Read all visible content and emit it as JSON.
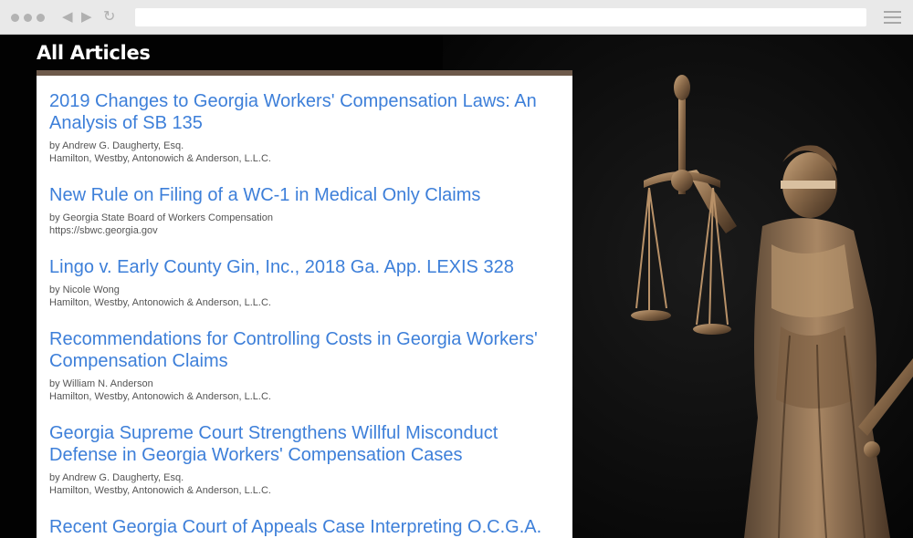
{
  "page": {
    "title": "All Articles"
  },
  "articles": [
    {
      "title": "2019 Changes to Georgia Workers' Compensation Laws: An Analysis of SB 135",
      "author": "by Andrew G. Daugherty, Esq.",
      "firm": "Hamilton, Westby, Antonowich & Anderson, L.L.C."
    },
    {
      "title": "New Rule on Filing of a WC-1 in Medical Only Claims",
      "author": "by Georgia State Board of Workers Compensation",
      "firm": "https://sbwc.georgia.gov"
    },
    {
      "title": "Lingo v. Early County Gin, Inc., 2018 Ga. App. LEXIS 328",
      "author": "by Nicole Wong",
      "firm": "Hamilton, Westby, Antonowich & Anderson, L.L.C."
    },
    {
      "title": "Recommendations for Controlling Costs in Georgia Workers' Compensation Claims",
      "author": "by William N. Anderson",
      "firm": "Hamilton, Westby, Antonowich & Anderson, L.L.C."
    },
    {
      "title": "Georgia Supreme Court Strengthens Willful Misconduct Defense in Georgia Workers' Compensation Cases",
      "author": "by Andrew G. Daugherty, Esq.",
      "firm": "Hamilton, Westby, Antonowich & Anderson, L.L.C."
    },
    {
      "title": "Recent Georgia Court of Appeals Case Interpreting O.C.G.A."
    }
  ],
  "colors": {
    "link": "#3d7fd9",
    "accent_bar": "#6e5a4b",
    "statue_bronze": "#8a6a4a"
  }
}
